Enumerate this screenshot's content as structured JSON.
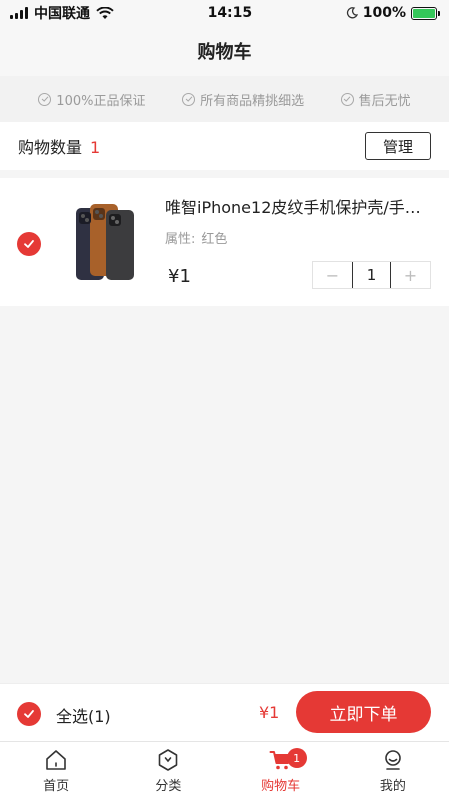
{
  "status_bar": {
    "carrier": "中国联通",
    "time": "14:15",
    "battery": "100%"
  },
  "nav": {
    "title": "购物车"
  },
  "assurances": [
    {
      "label": "100%正品保证",
      "icon": "check-circle-icon"
    },
    {
      "label": "所有商品精挑细选",
      "icon": "check-circle-icon"
    },
    {
      "label": "售后无忧",
      "icon": "check-circle-icon"
    }
  ],
  "cart_count": {
    "label": "购物数量",
    "count": "1",
    "manage_label": "管理"
  },
  "item": {
    "title": "唯智iPhone12皮纹手机保护壳/手…",
    "attr_label": "属性:",
    "attr_value": "红色",
    "price": "¥1",
    "quantity": "1",
    "minus": "−",
    "plus": "+",
    "checked": true
  },
  "checkout": {
    "select_all_label": "全选(1)",
    "total": "¥1",
    "order_label": "立即下单"
  },
  "tabs": [
    {
      "label": "首页",
      "icon": "home-icon",
      "active": false
    },
    {
      "label": "分类",
      "icon": "category-icon",
      "active": false
    },
    {
      "label": "购物车",
      "icon": "cart-icon",
      "active": true,
      "badge": "1"
    },
    {
      "label": "我的",
      "icon": "profile-icon",
      "active": false
    }
  ],
  "colors": {
    "accent": "#e53935",
    "background": "#f5f5f5",
    "muted_text": "#9a9a9a"
  }
}
